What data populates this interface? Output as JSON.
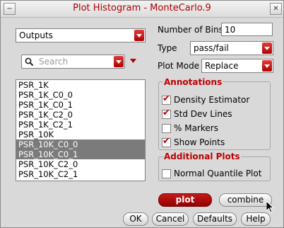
{
  "window": {
    "title": "Plot Histogram - MonteCarlo.9"
  },
  "titlebar": {
    "minimize_icon": "minus-icon",
    "close_icon": "x-icon"
  },
  "left": {
    "source_dropdown": {
      "value": "Outputs"
    },
    "search": {
      "placeholder": "Search",
      "icon": "search-icon"
    },
    "list_items": [
      {
        "label": "PSR_1K",
        "selected": false
      },
      {
        "label": "PSR_1K_C0_0",
        "selected": false
      },
      {
        "label": "PSR_1K_C0_1",
        "selected": false
      },
      {
        "label": "PSR_1K_C2_0",
        "selected": false
      },
      {
        "label": "PSR_1K_C2_1",
        "selected": false
      },
      {
        "label": "PSR_10K",
        "selected": false
      },
      {
        "label": "PSR_10K_C0_0",
        "selected": true
      },
      {
        "label": "PSR_10K_C0_1",
        "selected": true
      },
      {
        "label": "PSR_10K_C2_0",
        "selected": false
      },
      {
        "label": "PSR_10K_C2_1",
        "selected": false
      }
    ]
  },
  "right": {
    "bins_label": "Number of Bins",
    "bins_value": "10",
    "type_label": "Type",
    "type_value": "pass/fail",
    "plot_mode_label": "Plot Mode",
    "plot_mode_value": "Replace",
    "annotations": {
      "title": "Annotations",
      "items": [
        {
          "label": "Density Estimator",
          "checked": true
        },
        {
          "label": "Std Dev Lines",
          "checked": true
        },
        {
          "label": "% Markers",
          "checked": false
        },
        {
          "label": "Show Points",
          "checked": true
        }
      ]
    },
    "additional": {
      "title": "Additional Plots",
      "items": [
        {
          "label": "Normal Quantile Plot",
          "checked": false
        }
      ]
    }
  },
  "buttons": {
    "plot": "plot",
    "combine": "combine",
    "ok": "OK",
    "cancel": "Cancel",
    "defaults": "Defaults",
    "help": "Help"
  },
  "colors": {
    "accent": "#c00000",
    "selection": "#7b7b7b"
  }
}
